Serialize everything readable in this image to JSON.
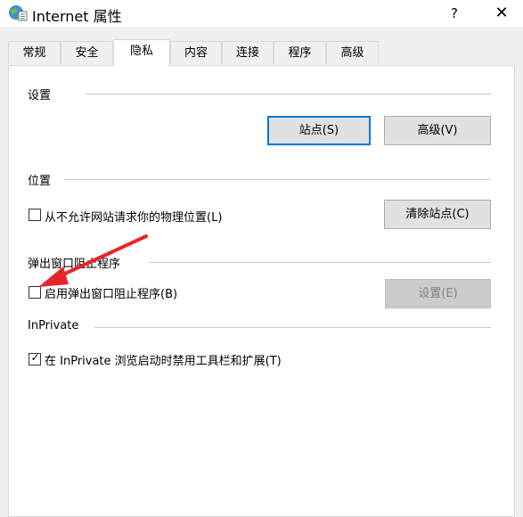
{
  "window": {
    "title": "Internet 属性",
    "help": "?",
    "close": "✕"
  },
  "tabs": [
    {
      "label": "常规"
    },
    {
      "label": "安全"
    },
    {
      "label": "隐私"
    },
    {
      "label": "内容"
    },
    {
      "label": "连接"
    },
    {
      "label": "程序"
    },
    {
      "label": "高级"
    }
  ],
  "active_tab": "隐私",
  "settings": {
    "heading": "设置",
    "sites_button": "站点(S)",
    "advanced_button": "高级(V)"
  },
  "location": {
    "heading": "位置",
    "checkbox_label": "从不允许网站请求你的物理位置(L)",
    "checked": false,
    "clear_button": "清除站点(C)"
  },
  "popup_blocker": {
    "heading": "弹出窗口阻止程序",
    "checkbox_label": "启用弹出窗口阻止程序(B)",
    "checked": false,
    "settings_button": "设置(E)"
  },
  "inprivate": {
    "heading": "InPrivate",
    "checkbox_label": "在 InPrivate 浏览启动时禁用工具栏和扩展(T)",
    "checked": true,
    "check_glyph": "✓"
  },
  "colors": {
    "accent": "#0078d7",
    "annotation_arrow": "#e8262a"
  }
}
